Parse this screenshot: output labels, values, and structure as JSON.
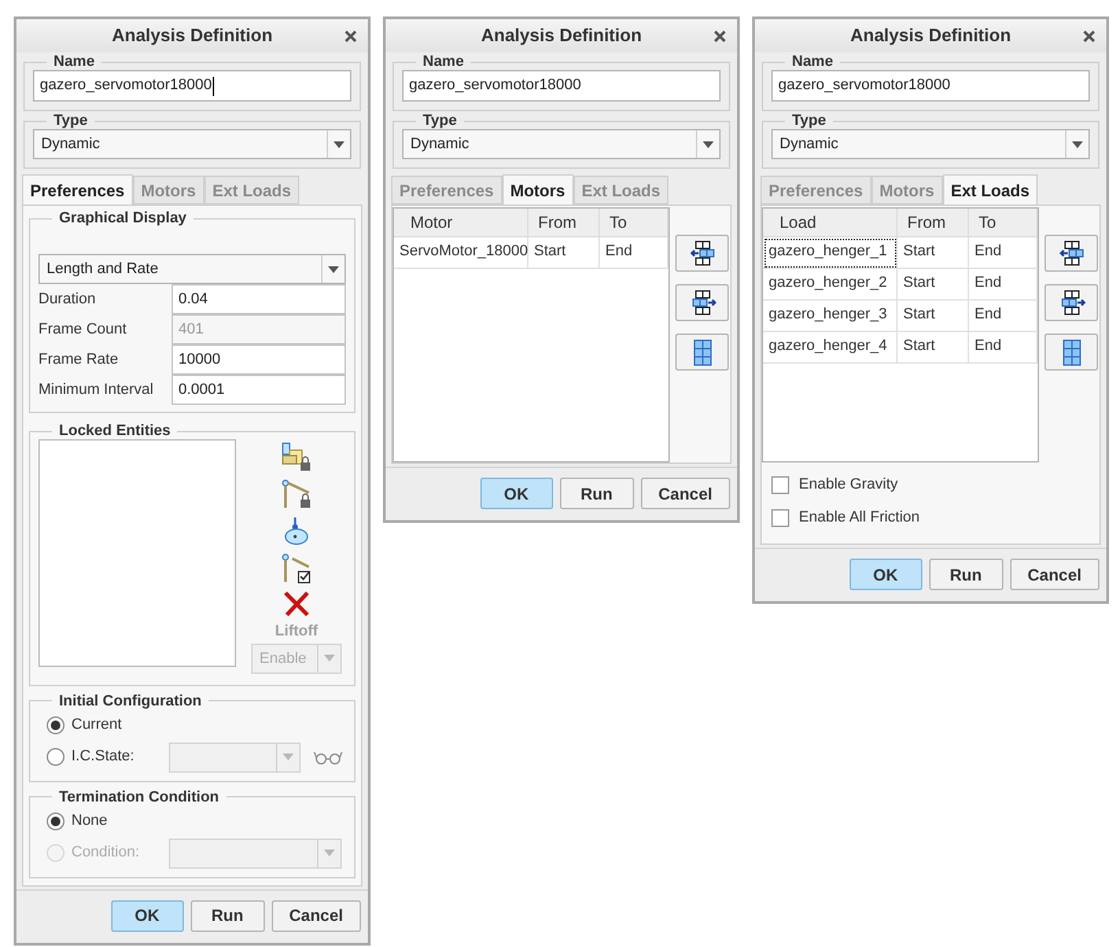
{
  "dialogs": [
    {
      "title": "Analysis Definition",
      "name": {
        "label": "Name",
        "value": "gazero_servomotor18000",
        "focused": true
      },
      "type": {
        "label": "Type",
        "value": "Dynamic"
      },
      "tabs": [
        {
          "label": "Preferences",
          "selected": true
        },
        {
          "label": "Motors",
          "selected": false
        },
        {
          "label": "Ext Loads",
          "selected": false
        }
      ],
      "panel": {
        "kind": "preferences",
        "graphical_display": {
          "title": "Graphical Display",
          "mode": "Length and Rate",
          "fields": [
            {
              "label": "Duration",
              "value": "0.04",
              "disabled": false
            },
            {
              "label": "Frame Count",
              "value": "401",
              "disabled": true
            },
            {
              "label": "Frame Rate",
              "value": "10000",
              "disabled": false
            },
            {
              "label": "Minimum Interval",
              "value": "0.0001",
              "disabled": false
            }
          ]
        },
        "locked_entities": {
          "title": "Locked Entities",
          "liftoff_label": "Liftoff",
          "liftoff_value": "Enable"
        },
        "initial_configuration": {
          "title": "Initial Configuration",
          "options": [
            {
              "label": "Current",
              "selected": true,
              "disabled": false,
              "has_dropdown": false
            },
            {
              "label": "I.C.State:",
              "selected": false,
              "disabled": false,
              "has_dropdown": true
            }
          ]
        },
        "termination_condition": {
          "title": "Termination Condition",
          "options": [
            {
              "label": "None",
              "selected": true,
              "disabled": false,
              "has_dropdown": false
            },
            {
              "label": "Condition:",
              "selected": false,
              "disabled": true,
              "has_dropdown": true
            }
          ]
        }
      },
      "buttons": [
        {
          "label": "OK",
          "default": true
        },
        {
          "label": "Run",
          "default": false
        },
        {
          "label": "Cancel",
          "default": false
        }
      ]
    },
    {
      "title": "Analysis Definition",
      "name": {
        "label": "Name",
        "value": "gazero_servomotor18000",
        "focused": false
      },
      "type": {
        "label": "Type",
        "value": "Dynamic"
      },
      "tabs": [
        {
          "label": "Preferences",
          "selected": false
        },
        {
          "label": "Motors",
          "selected": true
        },
        {
          "label": "Ext Loads",
          "selected": false
        }
      ],
      "panel": {
        "kind": "table",
        "columns": [
          "Motor",
          "From",
          "To"
        ],
        "rows": [
          {
            "cells": [
              "ServoMotor_18000",
              "Start",
              "End"
            ],
            "focused": false
          }
        ]
      },
      "buttons": [
        {
          "label": "OK",
          "default": true
        },
        {
          "label": "Run",
          "default": false
        },
        {
          "label": "Cancel",
          "default": false
        }
      ]
    },
    {
      "title": "Analysis Definition",
      "name": {
        "label": "Name",
        "value": "gazero_servomotor18000",
        "focused": false
      },
      "type": {
        "label": "Type",
        "value": "Dynamic"
      },
      "tabs": [
        {
          "label": "Preferences",
          "selected": false
        },
        {
          "label": "Motors",
          "selected": false
        },
        {
          "label": "Ext Loads",
          "selected": true
        }
      ],
      "panel": {
        "kind": "table",
        "columns": [
          "Load",
          "From",
          "To"
        ],
        "rows": [
          {
            "cells": [
              "gazero_henger_1",
              "Start",
              "End"
            ],
            "focused": true
          },
          {
            "cells": [
              "gazero_henger_2",
              "Start",
              "End"
            ],
            "focused": false
          },
          {
            "cells": [
              "gazero_henger_3",
              "Start",
              "End"
            ],
            "focused": false
          },
          {
            "cells": [
              "gazero_henger_4",
              "Start",
              "End"
            ],
            "focused": false
          }
        ],
        "checkboxes": [
          {
            "label": "Enable Gravity",
            "checked": false
          },
          {
            "label": "Enable All Friction",
            "checked": false
          }
        ]
      },
      "buttons": [
        {
          "label": "OK",
          "default": true
        },
        {
          "label": "Run",
          "default": false
        },
        {
          "label": "Cancel",
          "default": false
        }
      ]
    }
  ]
}
